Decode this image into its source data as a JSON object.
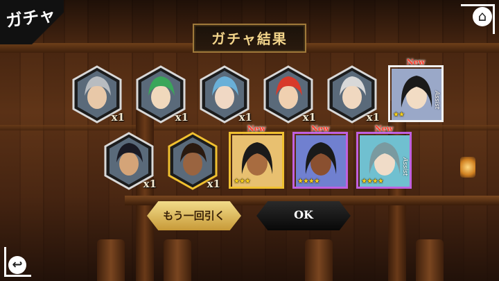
{
  "header": {
    "corner_title": "ガチャ",
    "title": "ガチャ結果"
  },
  "nav": {
    "home_icon": "home-icon",
    "back_icon": "back-arrow-icon"
  },
  "row1_hex": [
    {
      "qty": "x1",
      "hair": "#b8bcc0",
      "skin": "#e8c8a8",
      "ring": "#d8d8d8"
    },
    {
      "qty": "x1",
      "hair": "#3aa65a",
      "skin": "#f0d8bc",
      "ring": "#d8d8d8"
    },
    {
      "qty": "x1",
      "hair": "#6ab0d8",
      "skin": "#f0d8c4",
      "ring": "#d8d8d8"
    },
    {
      "qty": "x1",
      "hair": "#d83a2a",
      "skin": "#f0d0b0",
      "ring": "#d8d8d8"
    },
    {
      "qty": "x1",
      "hair": "#d8d8d8",
      "skin": "#f0d8c0",
      "ring": "#d8d8d8"
    }
  ],
  "row2_hex": [
    {
      "qty": "x1",
      "hair": "#1a1a24",
      "skin": "#d4a478",
      "ring": "#d8d8d8"
    },
    {
      "qty": "x1",
      "hair": "#2a1a10",
      "skin": "#9a6440",
      "ring": "#f0c030"
    }
  ],
  "rare_cards": [
    {
      "new": "New",
      "stars": "★★",
      "assist": "Assist",
      "frame": "#f2f2f2",
      "hair": "#1a1a1a",
      "skin": "#f2dcc4",
      "bg": "#9aa8c8"
    },
    {
      "new": "New",
      "stars": "★★★",
      "assist": "",
      "frame": "#f0c030",
      "hair": "#1a1a1a",
      "skin": "#a86c40",
      "bg": "#e8c070"
    },
    {
      "new": "New",
      "stars": "★★★★",
      "assist": "",
      "frame": "#c060e0",
      "hair": "#1a1a1a",
      "skin": "#8a5030",
      "bg": "#7080d0"
    },
    {
      "new": "New",
      "stars": "★★★★",
      "assist": "Assist",
      "frame": "#c060e0",
      "hair": "#7a9aa0",
      "skin": "#f0dcc8",
      "bg": "#70c0d0"
    }
  ],
  "buttons": {
    "again": "もう一回引く",
    "ok": "OK"
  }
}
